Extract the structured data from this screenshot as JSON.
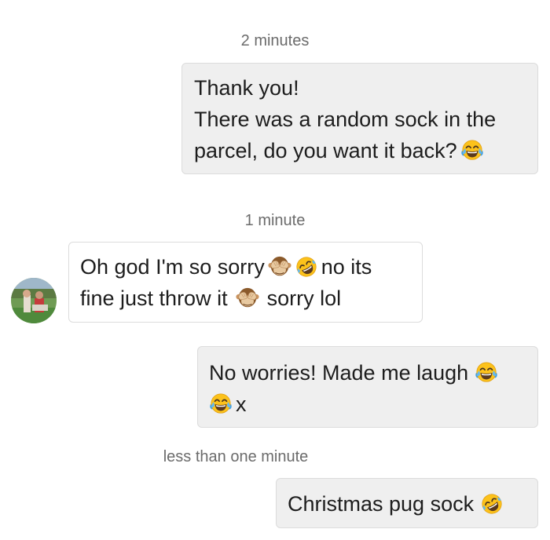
{
  "colors": {
    "outgoing_bubble": "#efefef",
    "incoming_bubble": "#ffffff",
    "timestamp_text": "#6b6b6b",
    "message_text": "#1d1d1d"
  },
  "messages": [
    {
      "timestamp": "2 minutes",
      "sender": "me",
      "line1": "Thank you!",
      "line2": "There was a random sock in the",
      "line3": "parcel, do you want it back?",
      "emoji": [
        "face-with-tears-of-joy-icon"
      ]
    },
    {
      "timestamp": "1 minute",
      "sender": "them",
      "line1_part1": "Oh god I'm so sorry",
      "line1_part2": "no its",
      "line2_part1": "fine just throw it",
      "line2_part2": "sorry lol",
      "emoji": [
        "see-no-evil-monkey-icon",
        "rolling-on-floor-laughing-icon",
        "see-no-evil-monkey-icon"
      ]
    },
    {
      "sender": "me",
      "line1": "No worries! Made me laugh",
      "line2": "x",
      "emoji": [
        "face-with-tears-of-joy-icon",
        "face-with-tears-of-joy-icon"
      ]
    },
    {
      "timestamp": "less than one minute",
      "sender": "me",
      "line1": "Christmas pug sock",
      "emoji": [
        "rolling-on-floor-laughing-icon"
      ]
    }
  ]
}
